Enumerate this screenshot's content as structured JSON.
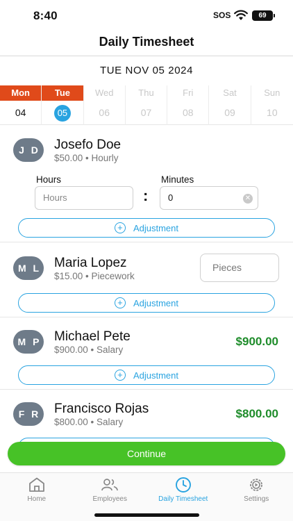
{
  "status": {
    "time": "8:40",
    "sos": "SOS",
    "battery": "69"
  },
  "header": {
    "title": "Daily Timesheet"
  },
  "date_heading": "TUE NOV 05 2024",
  "week": [
    {
      "day": "Mon",
      "num": "04",
      "state": "past"
    },
    {
      "day": "Tue",
      "num": "05",
      "state": "active"
    },
    {
      "day": "Wed",
      "num": "06",
      "state": "future"
    },
    {
      "day": "Thu",
      "num": "07",
      "state": "future"
    },
    {
      "day": "Fri",
      "num": "08",
      "state": "future"
    },
    {
      "day": "Sat",
      "num": "09",
      "state": "future"
    },
    {
      "day": "Sun",
      "num": "10",
      "state": "future"
    }
  ],
  "employees": [
    {
      "initials": "J D",
      "name": "Josefo Doe",
      "rate": "$50.00 • Hourly",
      "hours_label": "Hours",
      "hours_placeholder": "Hours",
      "minutes_label": "Minutes",
      "minutes_value": "0",
      "adjustment_label": "Adjustment"
    },
    {
      "initials": "M L",
      "name": "Maria Lopez",
      "rate": "$15.00 • Piecework",
      "pieces_placeholder": "Pieces",
      "adjustment_label": "Adjustment"
    },
    {
      "initials": "M P",
      "name": "Michael Pete",
      "rate": "$900.00 • Salary",
      "amount": "$900.00",
      "adjustment_label": "Adjustment"
    },
    {
      "initials": "F R",
      "name": "Francisco Rojas",
      "rate": "$800.00 • Salary",
      "amount": "$800.00"
    }
  ],
  "colon": ":",
  "continue_label": "Continue",
  "tabs": [
    {
      "label": "Home",
      "icon": "home-icon"
    },
    {
      "label": "Employees",
      "icon": "employees-icon"
    },
    {
      "label": "Daily Timesheet",
      "icon": "clock-icon",
      "active": true
    },
    {
      "label": "Settings",
      "icon": "settings-icon"
    }
  ],
  "colors": {
    "accent": "#29a3e0",
    "past_day": "#e04a1a",
    "money": "#1e8c2a",
    "continue": "#47c227",
    "avatar": "#6e7b89"
  }
}
